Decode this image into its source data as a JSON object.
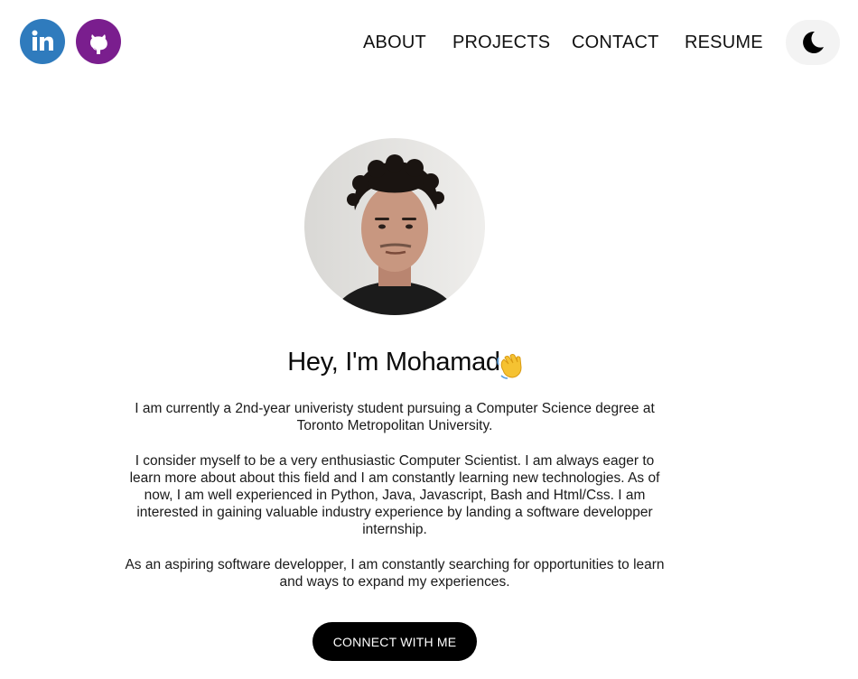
{
  "social": {
    "linkedin": {
      "icon": "linkedin-icon",
      "color": "#2f7bbd"
    },
    "github": {
      "icon": "github-icon",
      "color": "#7a1e8e"
    }
  },
  "nav": {
    "items": [
      {
        "label": "ABOUT"
      },
      {
        "label": "PROJECTS"
      },
      {
        "label": "CONTACT"
      },
      {
        "label": "RESUME"
      }
    ],
    "theme_toggle_icon": "moon-icon"
  },
  "hero": {
    "title": "Hey, I'm Mohamad",
    "title_emoji_icon": "waving-hand-icon",
    "paragraphs": [
      "I am currently a 2nd-year univeristy student pursuing a Computer Science degree at Toronto Metropolitan University.",
      "I consider myself to be a very enthusiastic Computer Scientist. I am always eager to learn more about about this field and I am constantly learning new technologies. As of now, I am well experienced in Python, Java, Javascript, Bash and Html/Css. I am interested in gaining valuable industry experience by landing a software developper internship.",
      "As an aspiring software developper, I am constantly searching for opportunities to learn and ways to expand my experiences."
    ],
    "cta_label": "CONNECT WITH ME"
  }
}
